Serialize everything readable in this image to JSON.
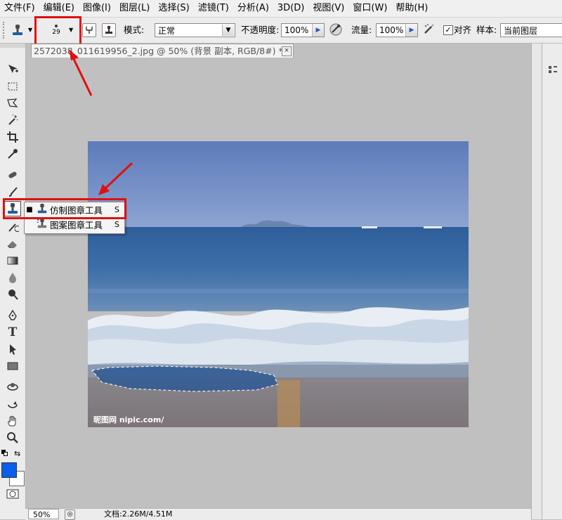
{
  "menu": [
    "文件(F)",
    "编辑(E)",
    "图像(I)",
    "图层(L)",
    "选择(S)",
    "滤镜(T)",
    "分析(A)",
    "3D(D)",
    "视图(V)",
    "窗口(W)",
    "帮助(H)"
  ],
  "options": {
    "brush_size": "29",
    "mode_label": "模式:",
    "mode_value": "正常",
    "opacity_label": "不透明度:",
    "opacity_value": "100%",
    "flow_label": "流量:",
    "flow_value": "100%",
    "align_label": "对齐",
    "align_checked": true,
    "sample_label": "样本:",
    "sample_value": "当前图层"
  },
  "document": {
    "tab_title": "2572038_011619956_2.jpg @ 50% (背景 副本, RGB/8#) *",
    "close_glyph": "×",
    "watermark": "昵图网 nipic.com/"
  },
  "flyout": {
    "items": [
      {
        "label": "仿制图章工具",
        "key": "S",
        "selected": true
      },
      {
        "label": "图案图章工具",
        "key": "S",
        "selected": false
      }
    ]
  },
  "status": {
    "zoom": "50%",
    "doc_info": "文档:2.26M/4.51M"
  },
  "colors": {
    "accent_red": "#e01010",
    "foreground_color": "#0a5fe8",
    "background_color": "#ffffff"
  },
  "icons": [
    "clone-stamp-icon",
    "brush-preset-icon",
    "move-icon",
    "marquee-icon",
    "lasso-icon",
    "magic-wand-icon",
    "crop-icon",
    "eyedropper-icon",
    "healing-icon",
    "brush-icon",
    "history-brush-icon",
    "eraser-icon",
    "gradient-icon",
    "blur-icon",
    "dodge-icon",
    "pen-icon",
    "type-icon",
    "path-select-icon",
    "rectangle-icon",
    "3d-rotate-icon",
    "3d-orbit-icon",
    "hand-icon",
    "zoom-icon",
    "quick-mask-icon"
  ]
}
